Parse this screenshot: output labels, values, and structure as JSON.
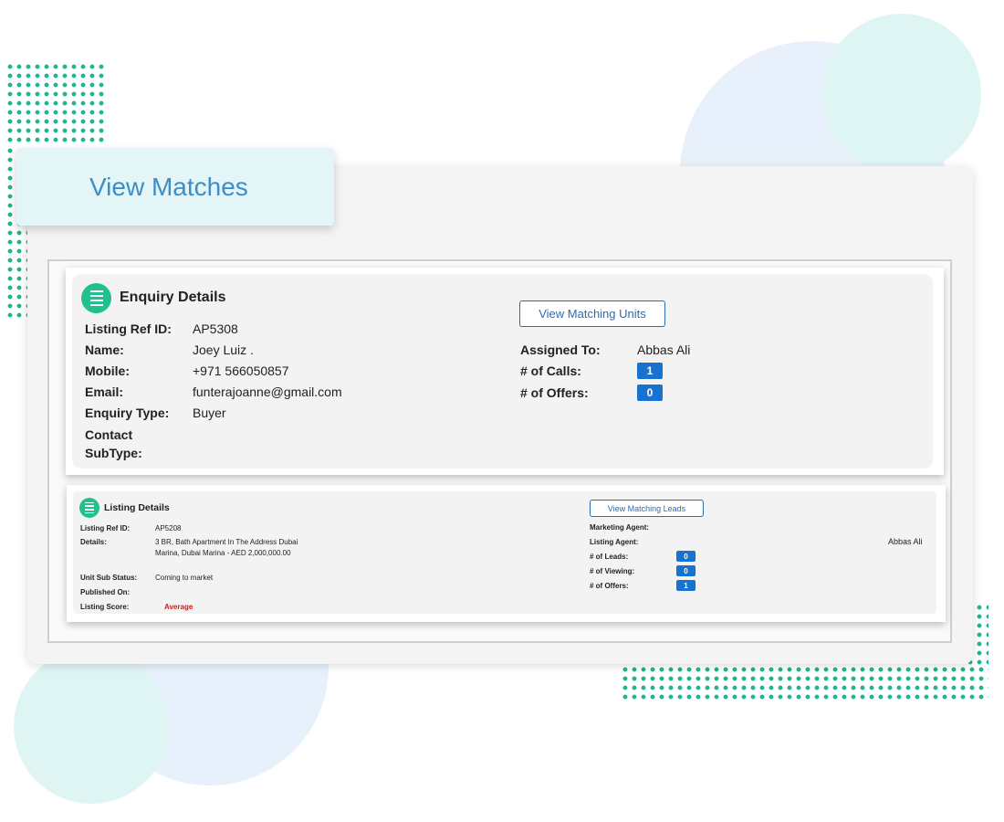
{
  "page_title": "View Matches",
  "enquiry": {
    "title": "Enquiry Details",
    "button_label": "View Matching Units",
    "fields": [
      {
        "label": "Listing Ref ID:",
        "value": "AP5308"
      },
      {
        "label": "Name:",
        "value": "Joey Luiz ."
      },
      {
        "label": "Mobile:",
        "value": "+971 566050857"
      },
      {
        "label": "Email:",
        "value": "funterajoanne@gmail.com"
      },
      {
        "label": "Enquiry Type:",
        "value": "Buyer"
      },
      {
        "label": "Contact SubType:",
        "value": ""
      }
    ],
    "assigned_to_label": "Assigned To:",
    "assigned_to_value": "Abbas Ali",
    "calls_label": "# of Calls:",
    "calls_value": "1",
    "offers_label": "# of Offers:",
    "offers_value": "0"
  },
  "listing": {
    "title": "Listing Details",
    "button_label": "View Matching Leads",
    "fields": [
      {
        "label": "Listing Ref ID:",
        "value": "AP5208"
      },
      {
        "label": "Details:",
        "value": "3 BR, Bath Apartment In The Address Dubai Marina, Dubai Marina - AED 2,000,000.00"
      },
      {
        "label": "Unit Sub Status:",
        "value": "Coming to market"
      },
      {
        "label": "Published On:",
        "value": ""
      },
      {
        "label": "Listing Score:",
        "value": "Average"
      }
    ],
    "marketing_agent_label": "Marketing Agent:",
    "marketing_agent_value": "",
    "listing_agent_label": "Listing Agent:",
    "listing_agent_value": "Abbas Ali",
    "leads_label": "# of Leads:",
    "leads_value": "0",
    "viewing_label": "# of Viewing:",
    "viewing_value": "0",
    "offers_label": "# of Offers:",
    "offers_value": "1"
  },
  "icons": {
    "section_icon": "list-icon"
  },
  "colors": {
    "accent_green": "#22c08f",
    "badge_blue": "#1772d0",
    "title_blue": "#3f8dc4",
    "score_red": "#d11a1a"
  }
}
